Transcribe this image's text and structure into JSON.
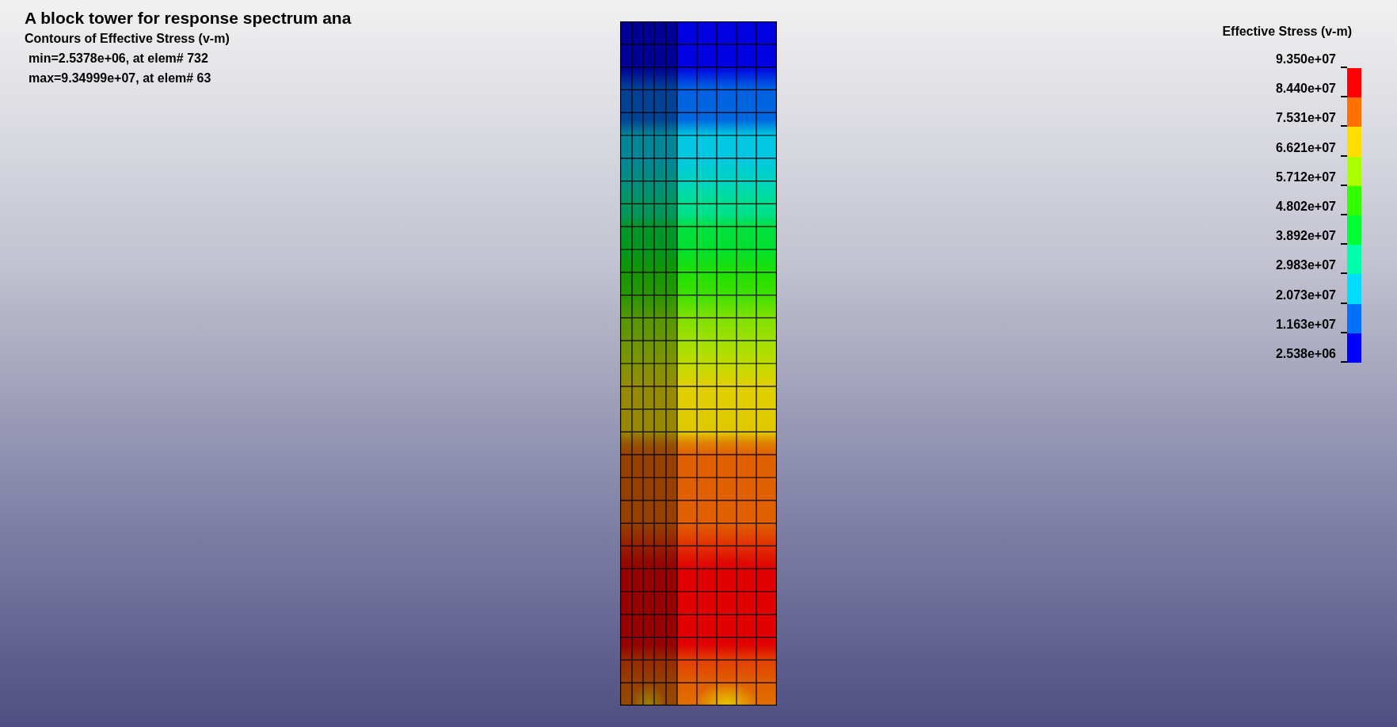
{
  "title": "A block tower for response spectrum ana",
  "subtitle": "Contours of Effective Stress (v-m)",
  "stats": [
    "min=2.5378e+06, at elem# 732",
    "max=9.34999e+07, at elem# 63"
  ],
  "legend": {
    "title": "Effective Stress (v-m)",
    "labels": [
      "9.350e+07",
      "8.440e+07",
      "7.531e+07",
      "6.621e+07",
      "5.712e+07",
      "4.802e+07",
      "3.892e+07",
      "2.983e+07",
      "2.073e+07",
      "1.163e+07",
      "2.538e+06"
    ],
    "bands": [
      {
        "color": "#ff0000"
      },
      {
        "color": "#ff7000"
      },
      {
        "color": "#ffdd00"
      },
      {
        "color": "#aaff00"
      },
      {
        "color": "#33ff00"
      },
      {
        "color": "#00ff33"
      },
      {
        "color": "#00ffaa"
      },
      {
        "color": "#00ddff"
      },
      {
        "color": "#0070ff"
      },
      {
        "color": "#0000ff"
      }
    ]
  }
}
